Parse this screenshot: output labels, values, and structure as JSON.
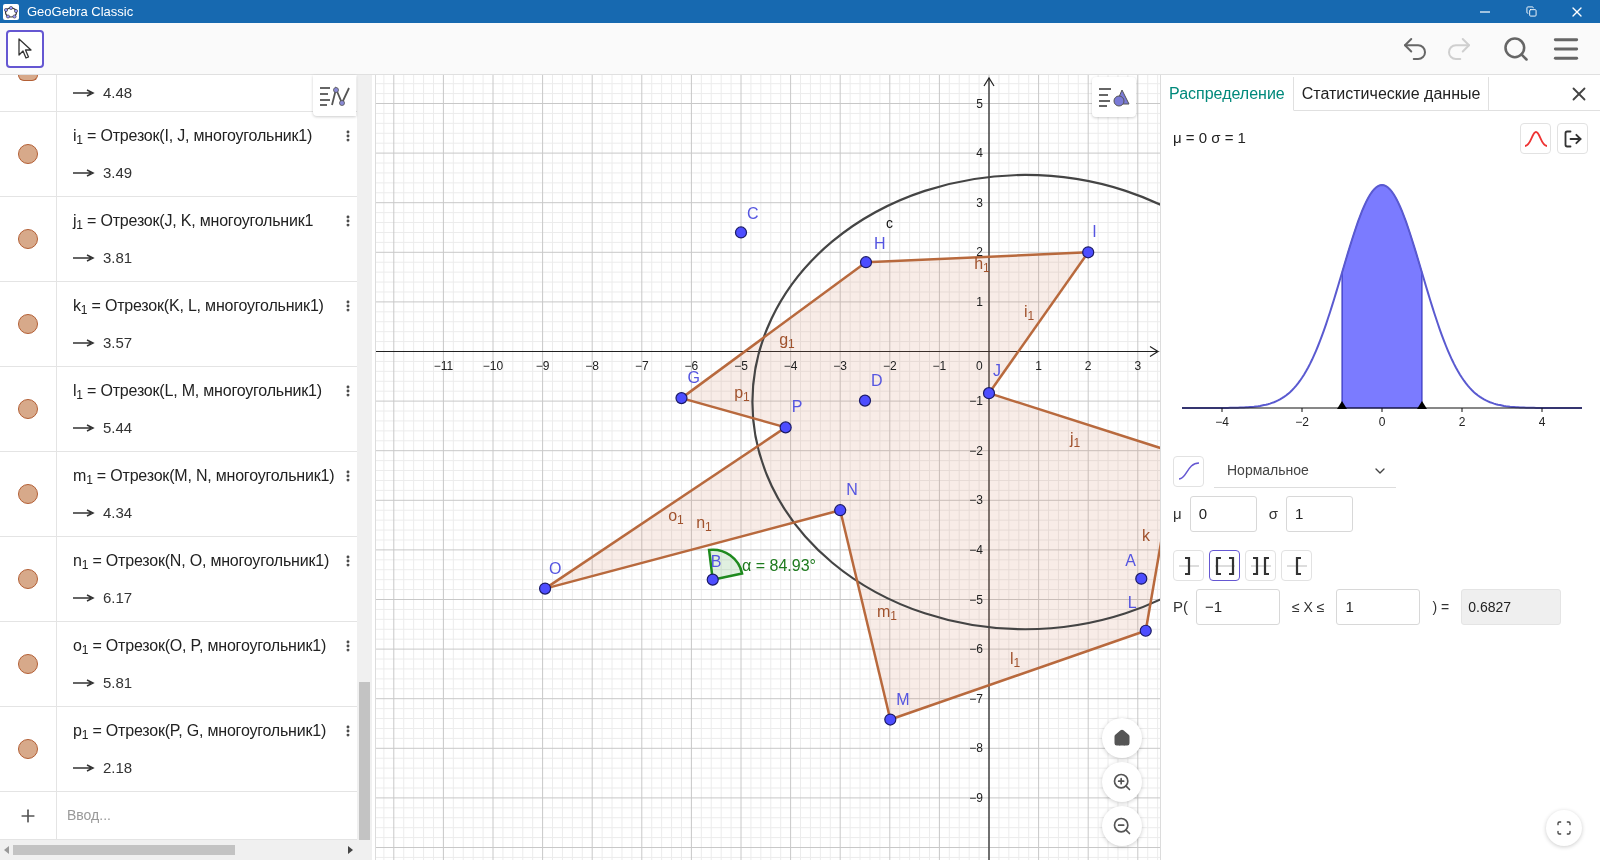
{
  "window": {
    "title": "GeoGebra Classic"
  },
  "toolbar": {
    "tools": [
      {
        "kind": "move",
        "selected": true
      }
    ],
    "undo": {
      "disabled": false
    },
    "redo": {
      "disabled": true
    }
  },
  "algebra": {
    "partial_value": "4.48",
    "rows": [
      {
        "definition": "i$_{1}$ = Отрезок(I, J, многоугольник1)",
        "value": "3.49",
        "visible": true
      },
      {
        "definition": "j$_{1}$ = Отрезок(J, K, многоугольник1",
        "value": "3.81",
        "visible": true
      },
      {
        "definition": "k$_{1}$ = Отрезок(K, L, многоугольник1)",
        "value": "3.57",
        "visible": true
      },
      {
        "definition": "l$_{1}$ = Отрезок(L, M, многоугольник1)",
        "value": "5.44",
        "visible": true
      },
      {
        "definition": "m$_{1}$ = Отрезок(M, N, многоугольник1)",
        "value": "4.34",
        "visible": true
      },
      {
        "definition": "n$_{1}$ = Отрезок(N, O, многоугольник1)",
        "value": "6.17",
        "visible": true
      },
      {
        "definition": "o$_{1}$ = Отрезок(O, P, многоугольник1)",
        "value": "5.81",
        "visible": true
      },
      {
        "definition": "p$_{1}$ = Отрезок(P, G, многоугольник1)",
        "value": "2.18",
        "visible": true
      }
    ],
    "input": {
      "placeholder": "Ввод..."
    }
  },
  "graphics": {
    "x_ticks": [
      "−11",
      "−10",
      "−9",
      "−8",
      "−7",
      "−6",
      "−5",
      "−4",
      "−3",
      "−2",
      "−1",
      "1",
      "2",
      "3"
    ],
    "y_ticks": [
      "5",
      "4",
      "3",
      "2",
      "1",
      "−1",
      "−2",
      "−3",
      "−4",
      "−5",
      "−6",
      "−7",
      "−8",
      "−9"
    ],
    "origin_label": "0",
    "points": [
      {
        "label": "C"
      },
      {
        "label": "H"
      },
      {
        "label": "I"
      },
      {
        "label": "J"
      },
      {
        "label": "G"
      },
      {
        "label": "P"
      },
      {
        "label": "D"
      },
      {
        "label": "N"
      },
      {
        "label": "O"
      },
      {
        "label": "B"
      },
      {
        "label": "M"
      },
      {
        "label": "L"
      },
      {
        "label": "A"
      }
    ],
    "segment_labels": [
      "g$_{1}$",
      "h$_{1}$",
      "i$_{1}$",
      "j$_{1}$",
      "k",
      "l$_{1}$",
      "m$_{1}$",
      "n$_{1}$",
      "o$_{1}$",
      "p$_{1}$"
    ],
    "curve_label": "c",
    "angle_label": "α = 84.93°"
  },
  "probability": {
    "tabs": [
      {
        "label": "Распределение",
        "selected": true
      },
      {
        "label": "Статистические данные",
        "selected": false
      }
    ],
    "summary": "μ = 0 σ = 1",
    "plot": {
      "xticks": [
        "−4",
        "−2",
        "0",
        "2",
        "4"
      ]
    },
    "distribution": "Нормальное",
    "params": [
      {
        "label": "μ",
        "value": "0"
      },
      {
        "label": "σ",
        "value": "1"
      }
    ],
    "interval_modes": [
      {
        "kind": "left",
        "selected": false
      },
      {
        "kind": "interval",
        "selected": true
      },
      {
        "kind": "two_tailed",
        "selected": false
      },
      {
        "kind": "right",
        "selected": false
      }
    ],
    "calc": {
      "prefix": "P(",
      "low": "−1",
      "middle": "≤ X ≤",
      "high": "1",
      "suffix": ") =",
      "result": "0.6827"
    }
  }
}
